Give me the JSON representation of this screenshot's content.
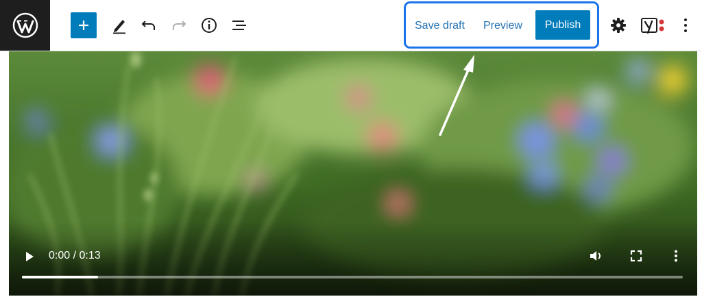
{
  "toolbar": {
    "logo_icon": "wordpress-logo-icon",
    "add_block_icon": "plus-icon",
    "tools": [
      {
        "icon": "pencil-icon"
      },
      {
        "icon": "undo-icon"
      },
      {
        "icon": "redo-icon"
      },
      {
        "icon": "info-icon"
      },
      {
        "icon": "list-view-icon"
      }
    ],
    "save_draft_label": "Save draft",
    "preview_label": "Preview",
    "publish_label": "Publish",
    "settings_icon": "gear-icon",
    "yoast_icon": "yoast-seo-icon",
    "more_icon": "vertical-ellipsis-icon",
    "accent_color": "#007cba",
    "highlight_color": "#1a73e8"
  },
  "video": {
    "time_display": "0:00 / 0:13",
    "progress_fraction": 0.115,
    "play_icon": "play-icon",
    "volume_icon": "volume-icon",
    "fullscreen_icon": "fullscreen-icon",
    "options_icon": "vertical-ellipsis-icon"
  }
}
